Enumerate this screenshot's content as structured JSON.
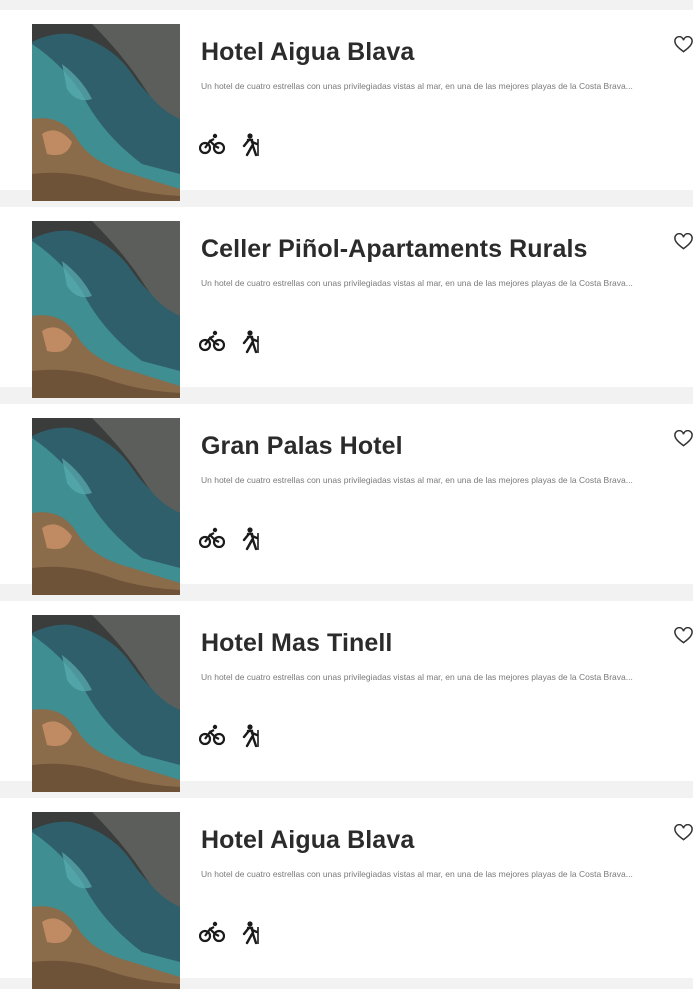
{
  "hotels": [
    {
      "name": "Hotel Aigua Blava",
      "description": "Un hotel de cuatro estrellas con unas privilegiadas vistas al mar, en una de las mejores playas de la Costa Brava...",
      "activities": [
        "cycling-icon",
        "hiking-icon"
      ],
      "favorite_icon": "heart-outline-icon"
    },
    {
      "name": "Celler Piñol-Apartaments Rurals",
      "description": "Un hotel de cuatro estrellas con unas privilegiadas vistas al mar, en una de las mejores playas de la Costa Brava...",
      "activities": [
        "cycling-icon",
        "hiking-icon"
      ],
      "favorite_icon": "heart-outline-icon"
    },
    {
      "name": "Gran Palas Hotel",
      "description": "Un hotel de cuatro estrellas con unas privilegiadas vistas al mar, en una de las mejores playas de la Costa Brava...",
      "activities": [
        "cycling-icon",
        "hiking-icon"
      ],
      "favorite_icon": "heart-outline-icon"
    },
    {
      "name": "Hotel Mas Tinell",
      "description": "Un hotel de cuatro estrellas con unas privilegiadas vistas al mar, en una de las mejores playas de la Costa Brava...",
      "activities": [
        "cycling-icon",
        "hiking-icon"
      ],
      "favorite_icon": "heart-outline-icon"
    },
    {
      "name": "Hotel Aigua Blava",
      "description": "Un hotel de cuatro estrellas con unas privilegiadas vistas al mar, en una de las mejores playas de la Costa Brava...",
      "activities": [
        "cycling-icon",
        "hiking-icon"
      ],
      "favorite_icon": "heart-outline-icon"
    }
  ],
  "colors": {
    "card_background": "#ffffff",
    "page_background": "#f2f2f2",
    "title": "#2b2b2b",
    "description": "#7a7a7a",
    "icon": "#1a1a1a"
  }
}
